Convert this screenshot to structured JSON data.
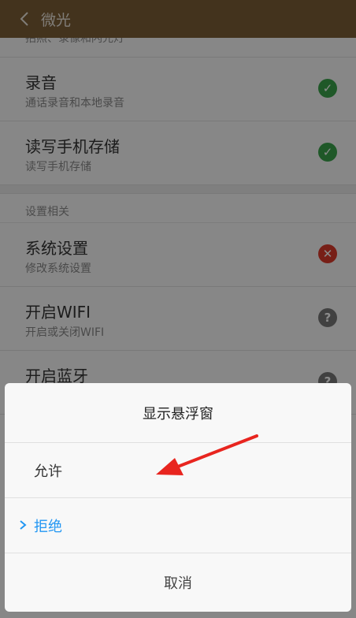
{
  "header": {
    "title": "微光"
  },
  "permissions": {
    "cut_subtitle": "拍照、录像和闪光灯",
    "items": [
      {
        "title": "录音",
        "subtitle": "通话录音和本地录音",
        "status": "allowed"
      },
      {
        "title": "读写手机存储",
        "subtitle": "读写手机存储",
        "status": "allowed"
      }
    ]
  },
  "settings_section": {
    "label": "设置相关",
    "items": [
      {
        "title": "系统设置",
        "subtitle": "修改系统设置",
        "status": "denied"
      },
      {
        "title": "开启WIFI",
        "subtitle": "开启或关闭WIFI",
        "status": "ask"
      },
      {
        "title": "开启蓝牙",
        "subtitle": "",
        "status": "ask"
      }
    ]
  },
  "dialog": {
    "title": "显示悬浮窗",
    "options": [
      {
        "label": "允许",
        "selected": false
      },
      {
        "label": "拒绝",
        "selected": true
      }
    ],
    "cancel_label": "取消"
  },
  "colors": {
    "header": "#7a5d35",
    "allowed": "#3aa14a",
    "denied": "#d93a2b",
    "ask": "#777777",
    "selected": "#2196f3",
    "annotation_arrow": "#e8251f"
  }
}
